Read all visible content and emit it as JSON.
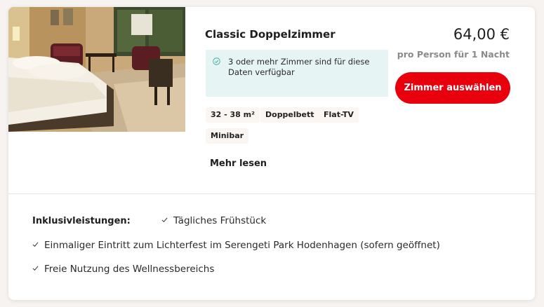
{
  "room": {
    "title": "Classic Doppelzimmer",
    "availability": "3 oder mehr Zimmer sind für diese Daten verfügbar",
    "features": [
      "32 - 38 m²",
      "Doppelbett",
      "Flat-TV",
      "Minibar"
    ],
    "read_more": "Mehr lesen",
    "photo_icon": "hotel-room-photo"
  },
  "pricing": {
    "price": "64,00 €",
    "per": "pro Person für 1 Nacht",
    "select_label": "Zimmer auswählen"
  },
  "inclusions": {
    "label": "Inklusivleistungen:",
    "items": [
      "Tägliches Frühstück",
      "Einmaliger Eintritt zum Lichterfest im Serengeti Park Hodenhagen (sofern geöffnet)",
      "Freie Nutzung des Wellnessbereichs"
    ]
  },
  "colors": {
    "accent": "#e8000d",
    "availability_bg": "#e6f5f4",
    "availability_icon": "#3cb39a",
    "muted_text": "#8a8a8a"
  }
}
